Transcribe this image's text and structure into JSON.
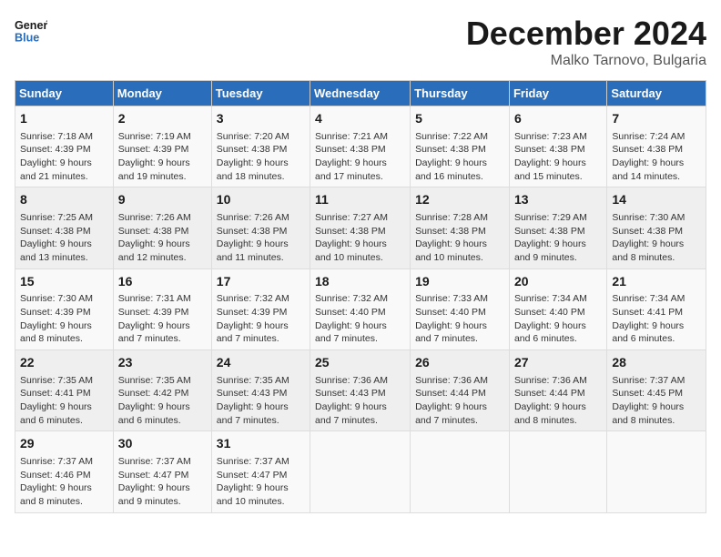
{
  "header": {
    "logo_line1": "General",
    "logo_line2": "Blue",
    "month": "December 2024",
    "location": "Malko Tarnovo, Bulgaria"
  },
  "days_of_week": [
    "Sunday",
    "Monday",
    "Tuesday",
    "Wednesday",
    "Thursday",
    "Friday",
    "Saturday"
  ],
  "weeks": [
    [
      {
        "day": "1",
        "info": "Sunrise: 7:18 AM\nSunset: 4:39 PM\nDaylight: 9 hours and 21 minutes."
      },
      {
        "day": "2",
        "info": "Sunrise: 7:19 AM\nSunset: 4:39 PM\nDaylight: 9 hours and 19 minutes."
      },
      {
        "day": "3",
        "info": "Sunrise: 7:20 AM\nSunset: 4:38 PM\nDaylight: 9 hours and 18 minutes."
      },
      {
        "day": "4",
        "info": "Sunrise: 7:21 AM\nSunset: 4:38 PM\nDaylight: 9 hours and 17 minutes."
      },
      {
        "day": "5",
        "info": "Sunrise: 7:22 AM\nSunset: 4:38 PM\nDaylight: 9 hours and 16 minutes."
      },
      {
        "day": "6",
        "info": "Sunrise: 7:23 AM\nSunset: 4:38 PM\nDaylight: 9 hours and 15 minutes."
      },
      {
        "day": "7",
        "info": "Sunrise: 7:24 AM\nSunset: 4:38 PM\nDaylight: 9 hours and 14 minutes."
      }
    ],
    [
      {
        "day": "8",
        "info": "Sunrise: 7:25 AM\nSunset: 4:38 PM\nDaylight: 9 hours and 13 minutes."
      },
      {
        "day": "9",
        "info": "Sunrise: 7:26 AM\nSunset: 4:38 PM\nDaylight: 9 hours and 12 minutes."
      },
      {
        "day": "10",
        "info": "Sunrise: 7:26 AM\nSunset: 4:38 PM\nDaylight: 9 hours and 11 minutes."
      },
      {
        "day": "11",
        "info": "Sunrise: 7:27 AM\nSunset: 4:38 PM\nDaylight: 9 hours and 10 minutes."
      },
      {
        "day": "12",
        "info": "Sunrise: 7:28 AM\nSunset: 4:38 PM\nDaylight: 9 hours and 10 minutes."
      },
      {
        "day": "13",
        "info": "Sunrise: 7:29 AM\nSunset: 4:38 PM\nDaylight: 9 hours and 9 minutes."
      },
      {
        "day": "14",
        "info": "Sunrise: 7:30 AM\nSunset: 4:38 PM\nDaylight: 9 hours and 8 minutes."
      }
    ],
    [
      {
        "day": "15",
        "info": "Sunrise: 7:30 AM\nSunset: 4:39 PM\nDaylight: 9 hours and 8 minutes."
      },
      {
        "day": "16",
        "info": "Sunrise: 7:31 AM\nSunset: 4:39 PM\nDaylight: 9 hours and 7 minutes."
      },
      {
        "day": "17",
        "info": "Sunrise: 7:32 AM\nSunset: 4:39 PM\nDaylight: 9 hours and 7 minutes."
      },
      {
        "day": "18",
        "info": "Sunrise: 7:32 AM\nSunset: 4:40 PM\nDaylight: 9 hours and 7 minutes."
      },
      {
        "day": "19",
        "info": "Sunrise: 7:33 AM\nSunset: 4:40 PM\nDaylight: 9 hours and 7 minutes."
      },
      {
        "day": "20",
        "info": "Sunrise: 7:34 AM\nSunset: 4:40 PM\nDaylight: 9 hours and 6 minutes."
      },
      {
        "day": "21",
        "info": "Sunrise: 7:34 AM\nSunset: 4:41 PM\nDaylight: 9 hours and 6 minutes."
      }
    ],
    [
      {
        "day": "22",
        "info": "Sunrise: 7:35 AM\nSunset: 4:41 PM\nDaylight: 9 hours and 6 minutes."
      },
      {
        "day": "23",
        "info": "Sunrise: 7:35 AM\nSunset: 4:42 PM\nDaylight: 9 hours and 6 minutes."
      },
      {
        "day": "24",
        "info": "Sunrise: 7:35 AM\nSunset: 4:43 PM\nDaylight: 9 hours and 7 minutes."
      },
      {
        "day": "25",
        "info": "Sunrise: 7:36 AM\nSunset: 4:43 PM\nDaylight: 9 hours and 7 minutes."
      },
      {
        "day": "26",
        "info": "Sunrise: 7:36 AM\nSunset: 4:44 PM\nDaylight: 9 hours and 7 minutes."
      },
      {
        "day": "27",
        "info": "Sunrise: 7:36 AM\nSunset: 4:44 PM\nDaylight: 9 hours and 8 minutes."
      },
      {
        "day": "28",
        "info": "Sunrise: 7:37 AM\nSunset: 4:45 PM\nDaylight: 9 hours and 8 minutes."
      }
    ],
    [
      {
        "day": "29",
        "info": "Sunrise: 7:37 AM\nSunset: 4:46 PM\nDaylight: 9 hours and 8 minutes."
      },
      {
        "day": "30",
        "info": "Sunrise: 7:37 AM\nSunset: 4:47 PM\nDaylight: 9 hours and 9 minutes."
      },
      {
        "day": "31",
        "info": "Sunrise: 7:37 AM\nSunset: 4:47 PM\nDaylight: 9 hours and 10 minutes."
      },
      null,
      null,
      null,
      null
    ]
  ]
}
